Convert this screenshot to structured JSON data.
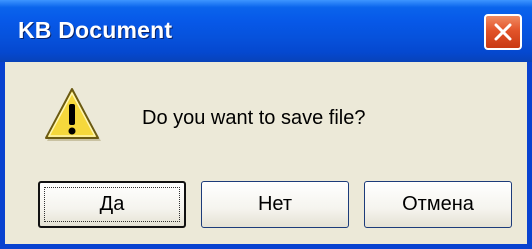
{
  "window": {
    "title": "KB Document"
  },
  "titlebar": {
    "close_icon": "close-icon"
  },
  "dialog": {
    "icon": "warning-icon",
    "message": "Do you want to save file?",
    "buttons": {
      "yes": "Да",
      "no": "Нет",
      "cancel": "Отмена"
    },
    "default_button": "yes"
  },
  "colors": {
    "titlebar": "#0758e8",
    "close_button": "#e2542a",
    "dialog_background": "#ece9d8",
    "warning_icon": "#f5d83c"
  }
}
